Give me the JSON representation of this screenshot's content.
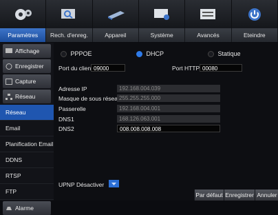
{
  "tabs": [
    {
      "name": "tab-parametres",
      "label": "Paramètres",
      "icon": "gears-icon"
    },
    {
      "name": "tab-rech-enreg",
      "label": "Rech. d'enreg.",
      "icon": "search-monitor-icon"
    },
    {
      "name": "tab-appareil",
      "label": "Appareil",
      "icon": "hard-drive-icon"
    },
    {
      "name": "tab-systeme",
      "label": "Système",
      "icon": "monitor-settings-icon"
    },
    {
      "name": "tab-avances",
      "label": "Avancés",
      "icon": "advanced-sliders-icon"
    },
    {
      "name": "tab-eteindre",
      "label": "Eteindre",
      "icon": "power-icon"
    }
  ],
  "sidebar": {
    "groups_top": [
      {
        "label": "Affichage",
        "icon": "display-icon"
      },
      {
        "label": "Enregistrer",
        "icon": "record-icon"
      },
      {
        "label": "Capture",
        "icon": "capture-icon"
      },
      {
        "label": "Réseau",
        "icon": "network-icon"
      }
    ],
    "subitems": [
      "Réseau",
      "Email",
      "Planification Email",
      "DDNS",
      "RTSP",
      "FTP"
    ],
    "groups_bottom": [
      {
        "label": "Alarme",
        "icon": "alarm-icon"
      }
    ]
  },
  "network": {
    "modes": [
      "PPPOE",
      "DHCP",
      "Statique"
    ],
    "selected_mode": "DHCP",
    "client_port_label": "Port du client",
    "client_port_value": "09000",
    "http_port_label": "Port HTTP",
    "http_port_value": "00080",
    "ip_label": "Adresse IP",
    "ip_value": "192.168.004.039",
    "mask_label": "Masque de sous réseau",
    "mask_value": "255.255.255.000",
    "gateway_label": "Passerelle",
    "gateway_value": "192.168.004.001",
    "dns1_label": "DNS1",
    "dns1_value": "168.126.063.001",
    "dns2_label": "DNS2",
    "dns2_value": "008.008.008.008",
    "upnp_label": "UPNP",
    "upnp_value": "Désactiver"
  },
  "buttons": {
    "default": "Par défaut",
    "save": "Enregistrer",
    "cancel": "Annuler"
  },
  "colors": {
    "accent": "#1f56b0",
    "radio_on": "#2e7ae8"
  }
}
